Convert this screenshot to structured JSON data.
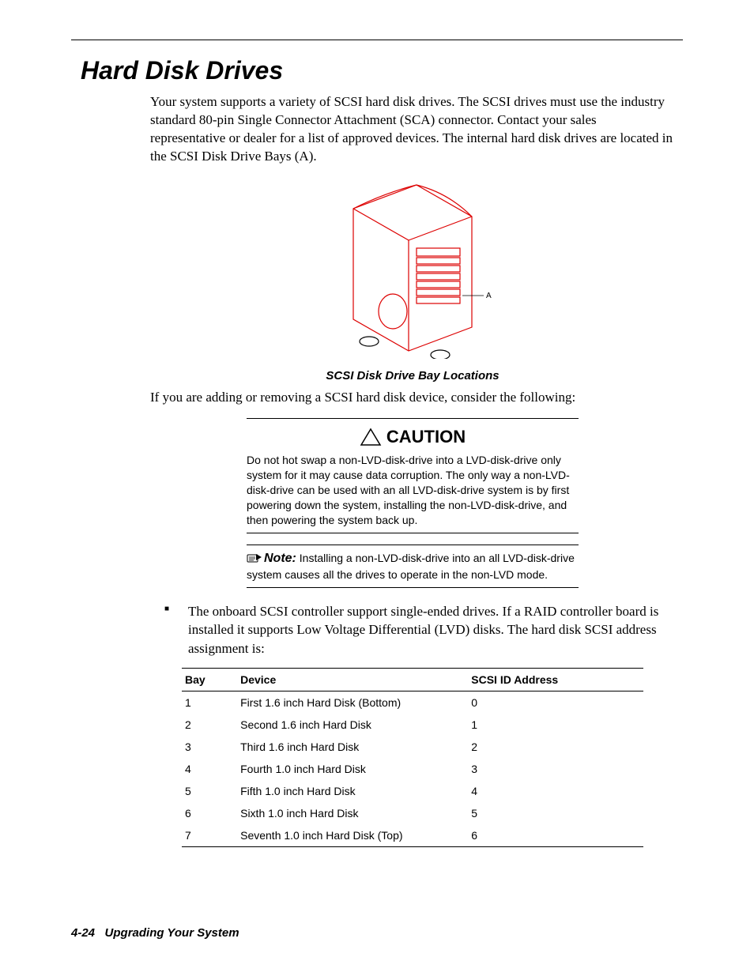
{
  "heading": "Hard Disk Drives",
  "intro": "Your system supports a variety of SCSI hard disk drives. The SCSI drives must use the industry standard 80-pin Single Connector Attachment (SCA) connector. Contact your sales representative or dealer for a list of approved devices. The internal hard disk drives are located in the SCSI Disk Drive Bays (A).",
  "figure": {
    "label_letter": "A",
    "caption": "SCSI Disk Drive Bay Locations"
  },
  "after_figure": "If you are adding or removing a SCSI hard disk device, consider the following:",
  "caution": {
    "title": "CAUTION",
    "body": "Do not hot swap a non-LVD-disk-drive into a LVD-disk-drive only system for it may cause data corruption. The only way a non-LVD-disk-drive can be used with an all LVD-disk-drive system is by first powering down the system, installing the non-LVD-disk-drive, and then powering the system back up."
  },
  "note": {
    "title": "Note:",
    "body": " Installing a non-LVD-disk-drive into an all LVD-disk-drive system causes all the drives to operate in the non-LVD mode."
  },
  "bullet": "The onboard SCSI controller support single-ended drives. If a RAID controller board is installed it supports Low Voltage Differential (LVD) disks. The hard disk SCSI address assignment is:",
  "table": {
    "headers": {
      "bay": "Bay",
      "device": "Device",
      "scsi": "SCSI ID Address"
    },
    "rows": [
      {
        "bay": "1",
        "device": "First 1.6 inch Hard Disk (Bottom)",
        "scsi": "0"
      },
      {
        "bay": "2",
        "device": "Second 1.6 inch Hard Disk",
        "scsi": "1"
      },
      {
        "bay": "3",
        "device": "Third 1.6 inch Hard Disk",
        "scsi": "2"
      },
      {
        "bay": "4",
        "device": "Fourth 1.0 inch Hard Disk",
        "scsi": "3"
      },
      {
        "bay": "5",
        "device": "Fifth 1.0 inch Hard Disk",
        "scsi": "4"
      },
      {
        "bay": "6",
        "device": "Sixth 1.0 inch Hard Disk",
        "scsi": "5"
      },
      {
        "bay": "7",
        "device": "Seventh 1.0 inch Hard Disk (Top)",
        "scsi": "6"
      }
    ]
  },
  "footer": {
    "page_num": "4-24",
    "section": "Upgrading Your System"
  }
}
